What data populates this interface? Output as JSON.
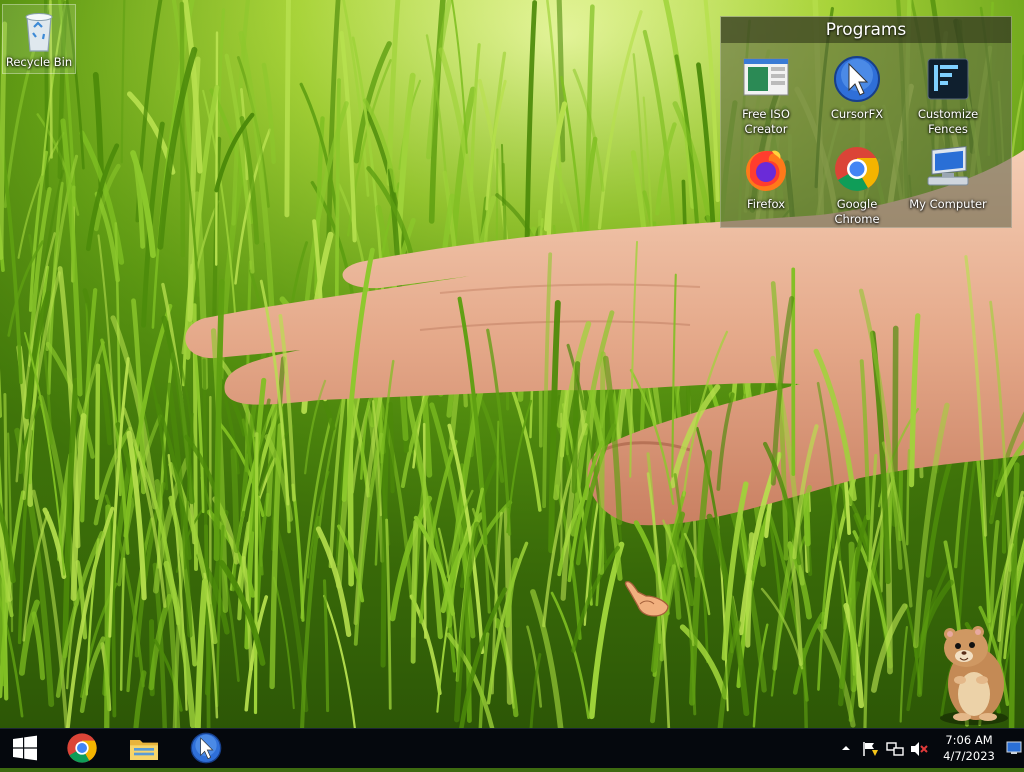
{
  "desktop": {
    "icons": [
      {
        "label": "Recycle Bin",
        "icon": "recycle-bin-icon"
      }
    ]
  },
  "fence": {
    "title": "Programs",
    "items": [
      {
        "line1": "Free ISO",
        "line2": "Creator",
        "icon": "iso-creator-icon"
      },
      {
        "line1": "CursorFX",
        "line2": "",
        "icon": "cursorfx-icon"
      },
      {
        "line1": "Customize",
        "line2": "Fences",
        "icon": "fences-icon"
      },
      {
        "line1": "Firefox",
        "line2": "",
        "icon": "firefox-icon"
      },
      {
        "line1": "Google",
        "line2": "Chrome",
        "icon": "chrome-icon"
      },
      {
        "line1": "My Computer",
        "line2": "",
        "icon": "computer-icon"
      }
    ]
  },
  "taskbar": {
    "pinned": [
      "chrome-icon",
      "file-explorer-icon",
      "cursorfx-icon"
    ],
    "tray_icons": [
      "show-hidden-icons-chevron",
      "action-center-flag-icon",
      "network-icon",
      "volume-muted-icon"
    ],
    "time": "7:06 AM",
    "date": "4/7/2023"
  },
  "colors": {
    "taskbar_bg": "#05080d",
    "start_accent": "#ffffff"
  }
}
